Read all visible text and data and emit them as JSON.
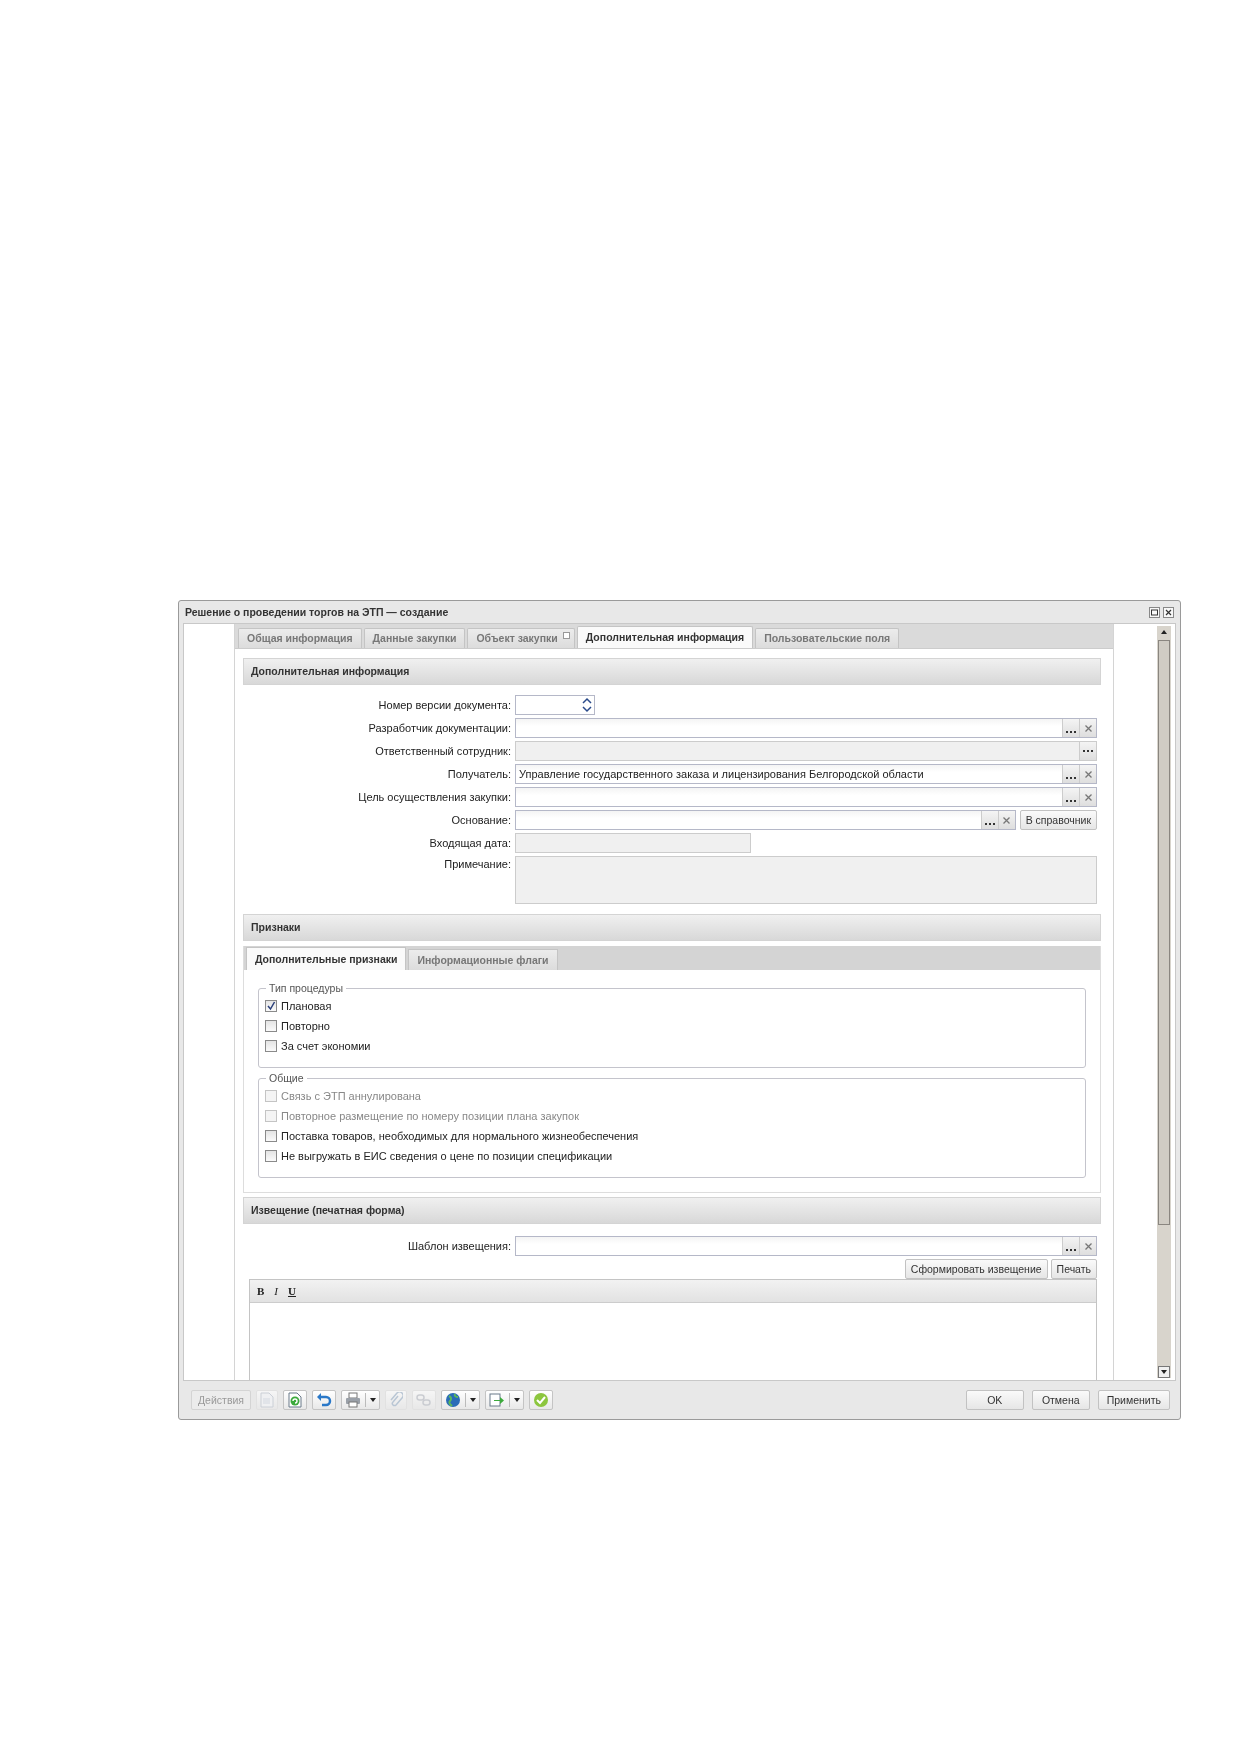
{
  "window": {
    "title": "Решение о проведении торгов на ЭТП — создание"
  },
  "tabs": [
    {
      "label": "Общая информация",
      "selected": false,
      "marked": false
    },
    {
      "label": "Данные закупки",
      "selected": false,
      "marked": false
    },
    {
      "label": "Объект закупки",
      "selected": false,
      "marked": true
    },
    {
      "label": "Дополнительная информация",
      "selected": true,
      "marked": false
    },
    {
      "label": "Пользовательские поля",
      "selected": false,
      "marked": false
    }
  ],
  "additional_info": {
    "title": "Дополнительная информация",
    "fields": [
      {
        "label": "Номер версии документа:",
        "kind": "spinner",
        "disabled": false
      },
      {
        "label": "Разработчик документации:",
        "kind": "lookup",
        "disabled": false
      },
      {
        "label": "Ответственный сотрудник:",
        "kind": "lookup",
        "disabled": true
      },
      {
        "label": "Получатель:",
        "kind": "lookup",
        "disabled": false,
        "value": "Управление государственного заказа и лицензирования Белгородской области"
      },
      {
        "label": "Цель осуществления закупки:",
        "kind": "lookup",
        "disabled": false
      },
      {
        "label": "Основание:",
        "kind": "lookup",
        "disabled": false,
        "button": "В справочник"
      },
      {
        "label": "Входящая дата:",
        "kind": "date",
        "disabled": true
      },
      {
        "label": "Примечание:",
        "kind": "textarea",
        "disabled": true
      }
    ]
  },
  "features": {
    "title": "Признаки",
    "tabs": [
      {
        "label": "Дополнительные признаки",
        "selected": true
      },
      {
        "label": "Информационные флаги",
        "selected": false
      }
    ],
    "groups": [
      {
        "legend": "Тип процедуры",
        "items": [
          {
            "label": "Плановая",
            "checked": true,
            "disabled": false
          },
          {
            "label": "Повторно",
            "checked": false,
            "disabled": false
          },
          {
            "label": "За счет экономии",
            "checked": false,
            "disabled": false
          }
        ]
      },
      {
        "legend": "Общие",
        "items": [
          {
            "label": "Связь с ЭТП аннулирована",
            "checked": false,
            "disabled": true
          },
          {
            "label": "Повторное размещение по номеру позиции плана закупок",
            "checked": false,
            "disabled": true
          },
          {
            "label": "Поставка товаров, необходимых для нормального жизнеобеспечения",
            "checked": false,
            "disabled": false
          },
          {
            "label": "Не выгружать в ЕИС сведения о цене по позиции спецификации",
            "checked": false,
            "disabled": false
          }
        ]
      }
    ]
  },
  "notice": {
    "title": "Извещение (печатная форма)",
    "template_label": "Шаблон извещения:",
    "buttons": [
      "Сформировать извещение",
      "Печать"
    ],
    "format_buttons": [
      {
        "label": "B",
        "kind": "bold"
      },
      {
        "label": "I",
        "kind": "italic"
      },
      {
        "label": "U",
        "kind": "underline"
      }
    ]
  },
  "toolbar": {
    "actions": {
      "label": "Действия",
      "disabled": true
    },
    "tools": [
      {
        "kind": "document",
        "disabled": true,
        "dropdown": false
      },
      {
        "kind": "refresh",
        "disabled": false,
        "dropdown": false
      },
      {
        "kind": "undo",
        "disabled": false,
        "dropdown": false
      },
      {
        "kind": "print",
        "disabled": false,
        "dropdown": true
      },
      {
        "kind": "attach",
        "disabled": true,
        "dropdown": false
      },
      {
        "kind": "link",
        "disabled": true,
        "dropdown": false
      },
      {
        "kind": "globe",
        "disabled": false,
        "dropdown": true
      },
      {
        "kind": "export",
        "disabled": false,
        "dropdown": true
      },
      {
        "kind": "check",
        "disabled": false,
        "dropdown": false
      }
    ]
  },
  "footer_buttons": [
    "OK",
    "Отмена",
    "Применить"
  ]
}
